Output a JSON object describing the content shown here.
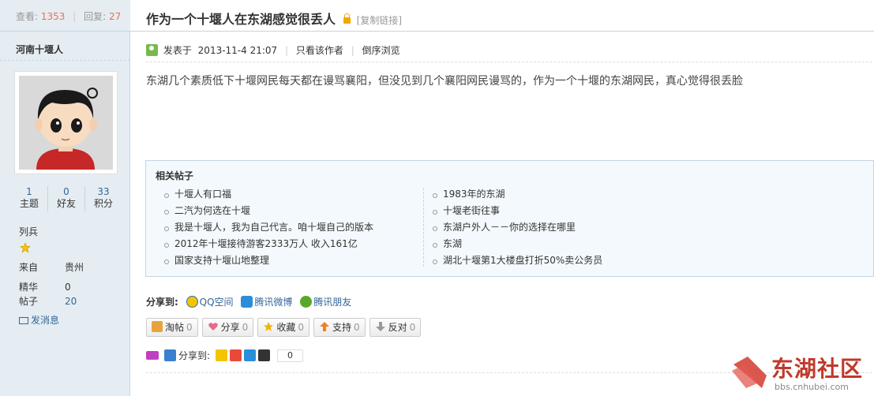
{
  "stats": {
    "views_label": "查看:",
    "views": "1353",
    "replies_label": "回复:",
    "replies": "27"
  },
  "author": {
    "name": "河南十堰人",
    "counts": [
      {
        "value": "1",
        "label": "主题"
      },
      {
        "value": "0",
        "label": "好友"
      },
      {
        "value": "33",
        "label": "积分"
      }
    ],
    "rank": "列兵",
    "from_label": "来自",
    "from_value": "贵州",
    "digest_label": "精华",
    "digest_value": "0",
    "posts_label": "帖子",
    "posts_value": "20",
    "message_label": "发消息"
  },
  "thread": {
    "title": "作为一个十堰人在东湖感觉很丢人",
    "copy_link": "[复制链接]"
  },
  "post": {
    "posted_label": "发表于",
    "posted_time": "2013-11-4 21:07",
    "only_author": "只看该作者",
    "reverse": "倒序浏览",
    "content": "东湖几个素质低下十堰网民每天都在谩骂襄阳，但没见到几个襄阳网民谩骂的，作为一个十堰的东湖网民，真心觉得很丢脸"
  },
  "related": {
    "title": "相关帖子",
    "left": [
      "十堰人有口福",
      "二汽为何选在十堰",
      "我是十堰人，我为自己代言。咱十堰自己的版本",
      "2012年十堰接待游客2333万人 收入161亿",
      "国家支持十堰山地整理"
    ],
    "right": [
      "1983年的东湖",
      "十堰老街往事",
      "东湖户外人－－你的选择在哪里",
      "东湖",
      "湖北十堰第1大楼盘打折50%卖公务员"
    ]
  },
  "share": {
    "label": "分享到:",
    "items": [
      "QQ空间",
      "腾讯微博",
      "腾讯朋友"
    ]
  },
  "actions": [
    {
      "label": "淘帖",
      "count": "0",
      "icon": "tray-icon",
      "color": "#e8a33c"
    },
    {
      "label": "分享",
      "count": "0",
      "icon": "heart-icon",
      "color": "#e86a8a"
    },
    {
      "label": "收藏",
      "count": "0",
      "icon": "star-icon",
      "color": "#f2b500"
    },
    {
      "label": "支持",
      "count": "0",
      "icon": "arrow-up-icon",
      "color": "#f08020"
    },
    {
      "label": "反对",
      "count": "0",
      "icon": "arrow-down-icon",
      "color": "#999999"
    }
  ],
  "share2": {
    "label": "分享到:",
    "count": "0"
  },
  "watermark": {
    "name": "东湖社区",
    "url": "bbs.cnhubei.com"
  }
}
